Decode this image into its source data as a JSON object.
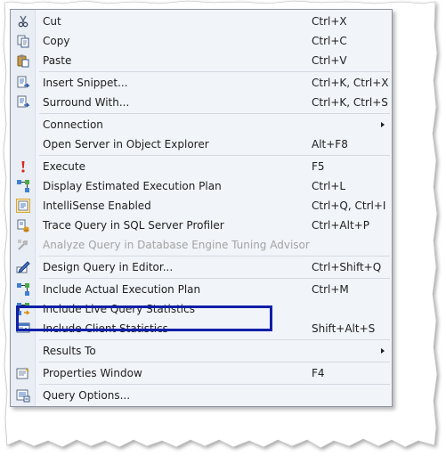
{
  "menu": {
    "items": [
      {
        "label": "Cut",
        "shortcut": "Ctrl+X"
      },
      {
        "label": "Copy",
        "shortcut": "Ctrl+C"
      },
      {
        "label": "Paste",
        "shortcut": "Ctrl+V"
      },
      {
        "label": "Insert Snippet...",
        "shortcut": "Ctrl+K, Ctrl+X"
      },
      {
        "label": "Surround With...",
        "shortcut": "Ctrl+K, Ctrl+S"
      },
      {
        "label": "Connection",
        "shortcut": ""
      },
      {
        "label": "Open Server in Object Explorer",
        "shortcut": "Alt+F8"
      },
      {
        "label": "Execute",
        "shortcut": "F5"
      },
      {
        "label": "Display Estimated Execution Plan",
        "shortcut": "Ctrl+L"
      },
      {
        "label": "IntelliSense Enabled",
        "shortcut": "Ctrl+Q, Ctrl+I"
      },
      {
        "label": "Trace Query in SQL Server Profiler",
        "shortcut": "Ctrl+Alt+P"
      },
      {
        "label": "Analyze Query in Database Engine Tuning Advisor",
        "shortcut": ""
      },
      {
        "label": "Design Query in Editor...",
        "shortcut": "Ctrl+Shift+Q"
      },
      {
        "label": "Include Actual Execution Plan",
        "shortcut": "Ctrl+M"
      },
      {
        "label": "Include Live Query Statistics",
        "shortcut": ""
      },
      {
        "label": "Include Client Statistics",
        "shortcut": "Shift+Alt+S"
      },
      {
        "label": "Results To",
        "shortcut": ""
      },
      {
        "label": "Properties Window",
        "shortcut": "F4"
      },
      {
        "label": "Query Options...",
        "shortcut": ""
      }
    ]
  },
  "colors": {
    "menu_bg": "#f1f4f9",
    "menu_border": "#8d96a4",
    "highlight_box": "#1020a8",
    "disabled_text": "#a3a3a3"
  }
}
